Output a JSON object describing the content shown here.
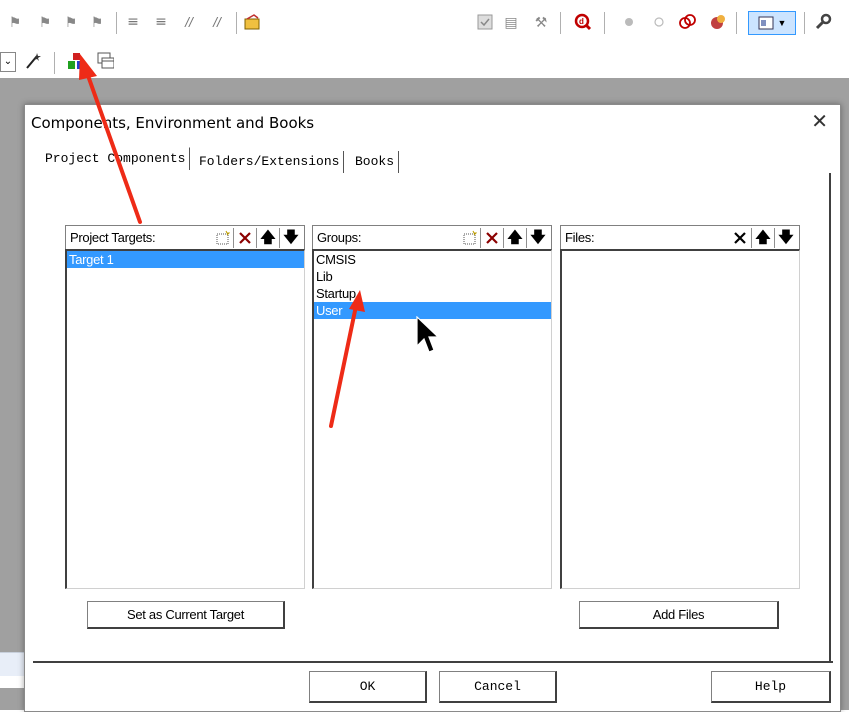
{
  "toolbar": {
    "row1_icons": [
      "bookmark-prev-icon",
      "bookmark-next-icon",
      "bookmark-clear-icon",
      "bookmark-all-icon",
      "indent-icon",
      "unindent-icon",
      "comment-icon",
      "uncomment-icon",
      "open-file-icon",
      "target-options-icon",
      "build-icon",
      "rebuild-icon",
      "debug-icon",
      "breakpoint-insert-icon",
      "breakpoint-disable-icon",
      "breakpoint-kill-icon",
      "stop-icon",
      "window-layout-icon",
      "dropdown-arrow-icon",
      "configure-icon"
    ],
    "row2_icons": [
      "select-dropdown-icon",
      "wand-icon",
      "manage-components-icon",
      "project-window-icon"
    ]
  },
  "dialog": {
    "title": "Components, Environment and Books",
    "close_glyph": "✕",
    "tabs": [
      {
        "label": "Project Components",
        "active": true
      },
      {
        "label": "Folders/Extensions",
        "active": false
      },
      {
        "label": "Books",
        "active": false
      }
    ],
    "targets": {
      "header": "Project Targets:",
      "items": [
        "Target 1"
      ],
      "selected_index": 0
    },
    "groups": {
      "header": "Groups:",
      "items": [
        "CMSIS",
        "Lib",
        "Startup",
        "User"
      ],
      "selected_index": 3
    },
    "files": {
      "header": "Files:",
      "items": []
    },
    "set_current_button": "Set as Current Target",
    "add_files_button": "Add Files",
    "ok_button": "OK",
    "cancel_button": "Cancel",
    "help_button": "Help"
  },
  "colors": {
    "selection": "#3399ff",
    "workarea": "#a0a0a0",
    "annotation_arrow": "#ee2b17"
  }
}
